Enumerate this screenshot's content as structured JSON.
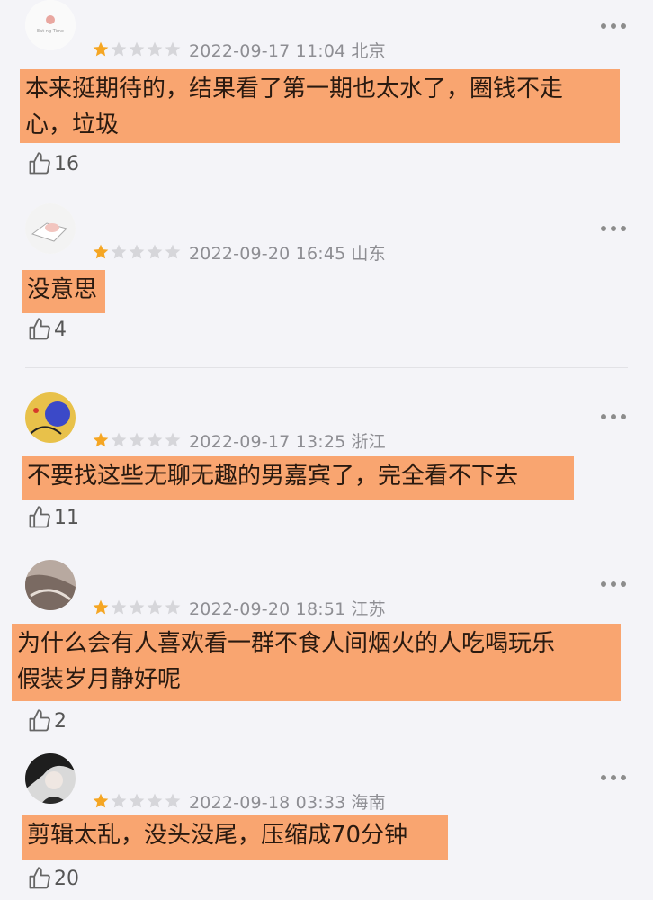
{
  "reviews": [
    {
      "avatar": "avatar-logo-icon",
      "rating": 1,
      "date": "2022-09-17 11:04",
      "location": "北京",
      "comment_lines": [
        "本来挺期待的，结果看了第一期也太水了，圈钱不走",
        "心，垃圾"
      ],
      "likes": "16",
      "avatar_text": "Eat ng Time"
    },
    {
      "avatar": "avatar-pig-icon",
      "rating": 1,
      "date": "2022-09-20 16:45",
      "location": "山东",
      "comment_lines": [
        "没意思"
      ],
      "likes": "4"
    },
    {
      "avatar": "avatar-art-icon",
      "rating": 1,
      "date": "2022-09-17 13:25",
      "location": "浙江",
      "comment_lines": [
        "不要找这些无聊无趣的男嘉宾了，完全看不下去"
      ],
      "likes": "11"
    },
    {
      "avatar": "avatar-photo-icon",
      "rating": 1,
      "date": "2022-09-20 18:51",
      "location": "江苏",
      "comment_lines": [
        "为什么会有人喜欢看一群不食人间烟火的人吃喝玩乐",
        "假装岁月静好呢"
      ],
      "likes": "2"
    },
    {
      "avatar": "avatar-person-icon",
      "rating": 1,
      "date": "2022-09-18 03:33",
      "location": "海南",
      "comment_lines": [
        "剪辑太乱，没头没尾，压缩成70分钟"
      ],
      "likes": "20"
    }
  ],
  "colors": {
    "highlight": "#f9a570",
    "star_filled": "#f5a623",
    "star_empty": "#d6d6da",
    "meta_text": "#8e8e93",
    "background": "#f4f4f8"
  }
}
